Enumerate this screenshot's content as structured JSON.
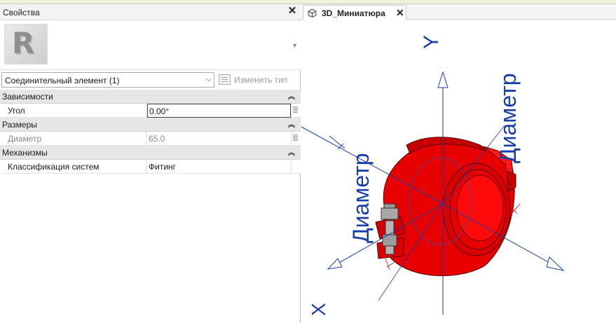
{
  "properties": {
    "title": "Свойства",
    "type_selector": {
      "value": "Соединительный элемент (1)"
    },
    "edit_type_label": "Изменить тип",
    "groups": [
      {
        "label": "Зависимости",
        "rows": [
          {
            "name": "Угол",
            "value": "0.00°"
          }
        ]
      },
      {
        "label": "Размеры",
        "rows": [
          {
            "name": "Диаметр",
            "value": "65.0"
          }
        ]
      },
      {
        "label": "Механизмы",
        "rows": [
          {
            "name": "Классификация систем",
            "value": "Фитинг"
          }
        ]
      }
    ]
  },
  "view": {
    "tab_label": "3D_Миниатюра",
    "axis_y": "Y",
    "axis_x": "X",
    "dim_label_left": "Диаметр",
    "dim_label_right": "Диаметр",
    "colors": {
      "fitting": "#e60000",
      "axes": "#1a3ea8"
    }
  },
  "icons": {
    "close": "close-icon",
    "collapse": "collapse-chevrons-icon",
    "view3d": "3d-view-icon",
    "dropdown": "chevron-down-icon"
  }
}
